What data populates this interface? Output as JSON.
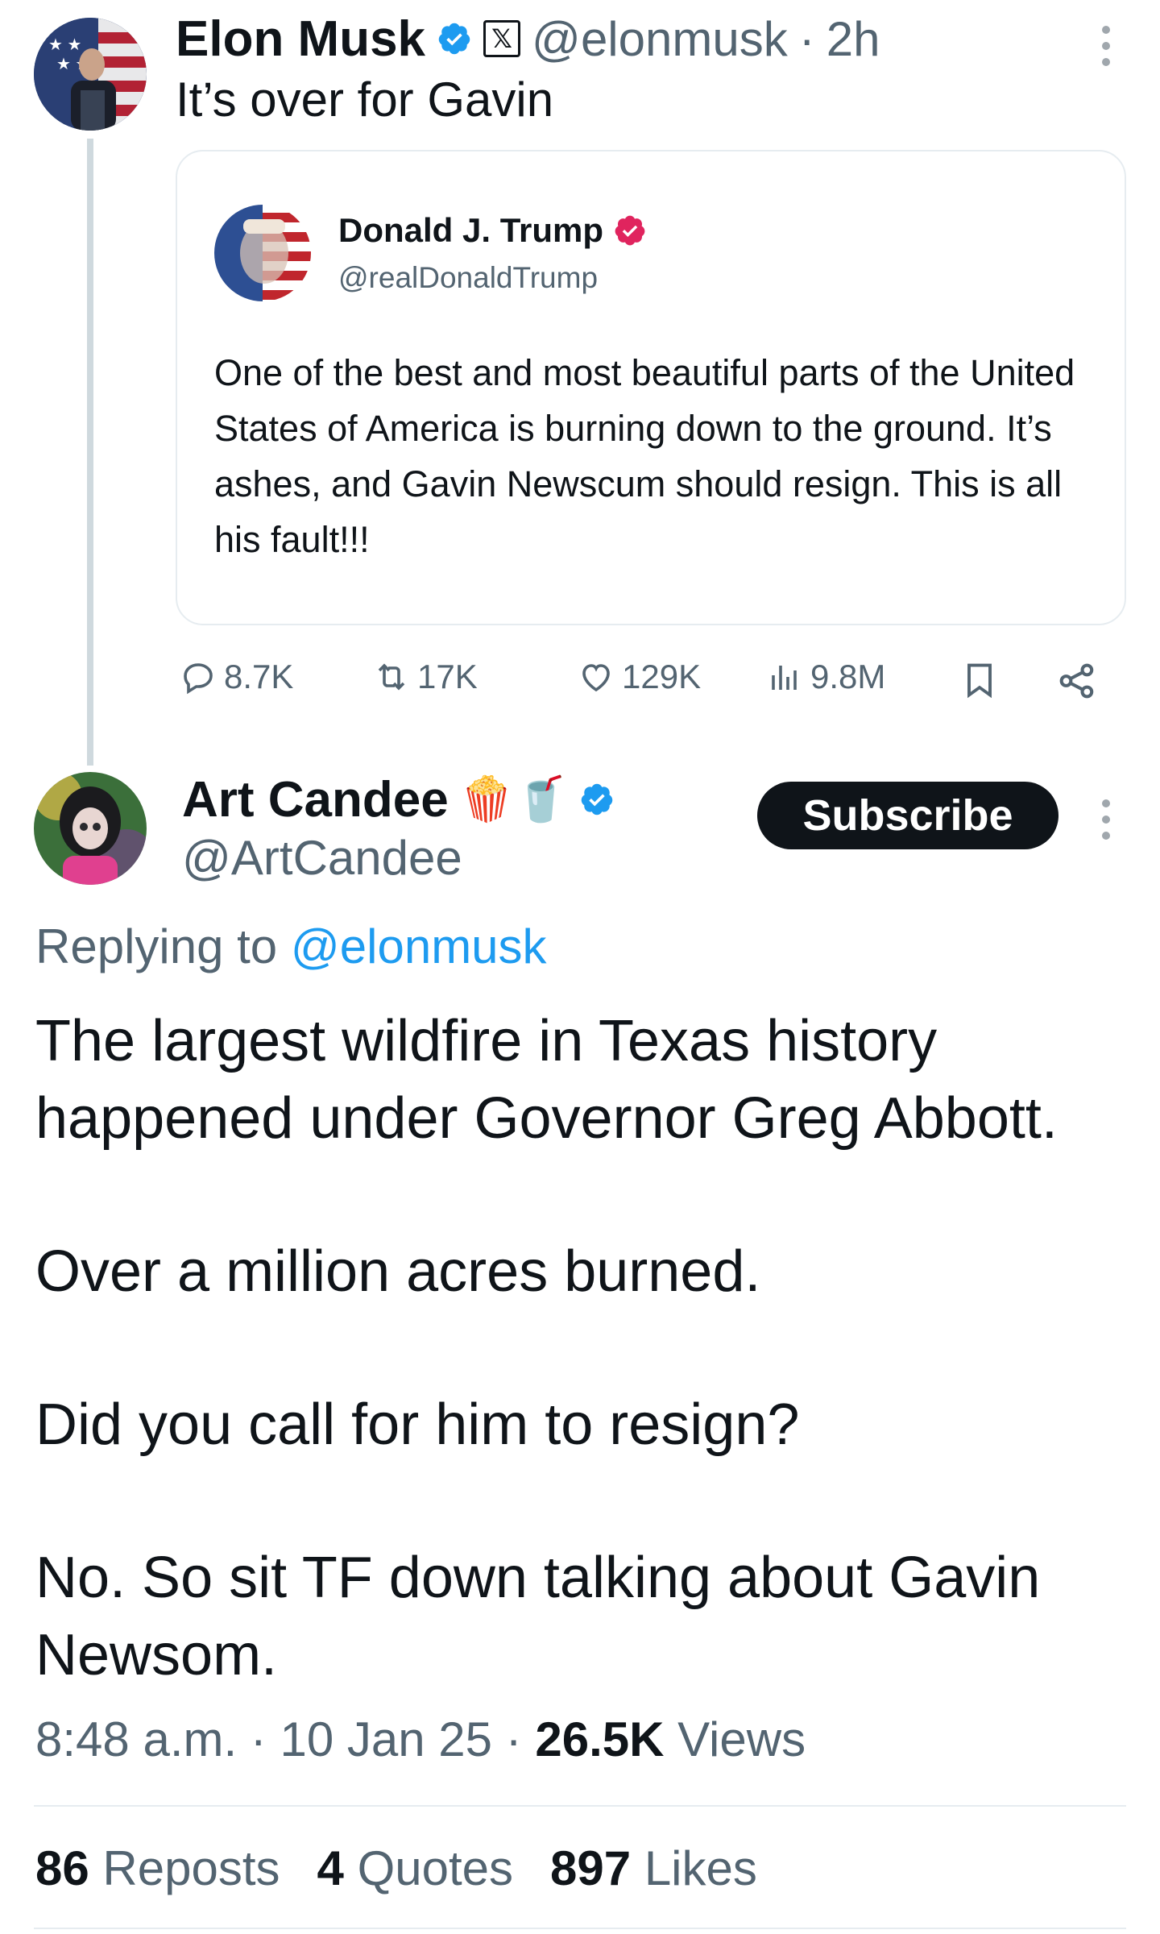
{
  "quoted_tweet": {
    "author": {
      "name": "Elon Musk",
      "handle": "@elonmusk",
      "time": "2h",
      "avatar": "elon-musk-avatar-with-flag"
    },
    "text": "It’s over for Gavin",
    "embedded": {
      "name": "Donald J. Trump",
      "handle": "@realDonaldTrump",
      "text": "One of the best and most beautiful parts of the United States of America is burning down to the ground. It’s ashes, and Gavin Newscum should resign. This is all his fault!!!"
    },
    "metrics": {
      "replies": "8.7K",
      "reposts": "17K",
      "likes": "129K",
      "views": "9.8M"
    }
  },
  "reply_tweet": {
    "author": {
      "name": "Art Candee",
      "emoji": "🍿🥤",
      "handle": "@ArtCandee"
    },
    "subscribe_label": "Subscribe",
    "replying_to_prefix": "Replying to",
    "replying_to_handle": "@elonmusk",
    "paragraphs": [
      "The largest wildfire in Texas history happened under Governor Greg Abbott.",
      "Over a million acres burned.",
      "Did you call for him to resign?",
      "No.  So sit TF down talking about Gavin Newsom."
    ],
    "timestamp": "8:48 a.m. · 10 Jan 25 · ",
    "views_count": "26.5K",
    "views_label": "Views",
    "stats": [
      {
        "count": "86",
        "label": "Reposts"
      },
      {
        "count": "4",
        "label": "Quotes"
      },
      {
        "count": "897",
        "label": "Likes"
      }
    ]
  },
  "colors": {
    "verified_blue": "#1d9bf0",
    "government_verified": "#e0245e",
    "text": "#0f1419",
    "muted": "#536471",
    "border": "#e6ecf0"
  }
}
